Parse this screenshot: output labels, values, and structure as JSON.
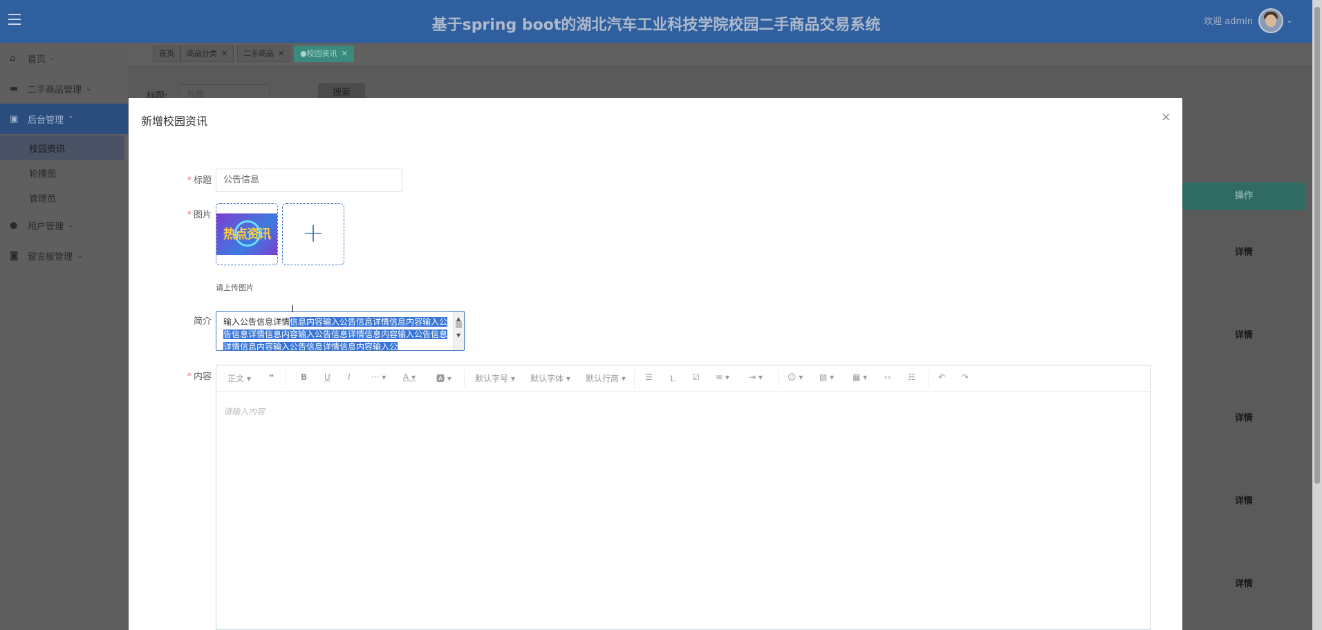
{
  "header": {
    "title": "基于spring boot的湖北汽车工业科技学院校园二手商品交易系统",
    "welcome": "欢迎 admin"
  },
  "sidebar": {
    "items": [
      {
        "label": "首页"
      },
      {
        "label": "二手商品管理"
      },
      {
        "label": "后台管理"
      },
      {
        "label": "用户管理"
      },
      {
        "label": "留言板管理"
      }
    ],
    "subitems": [
      {
        "label": "校园资讯"
      },
      {
        "label": "轮播图"
      },
      {
        "label": "管理员"
      }
    ]
  },
  "tabs": [
    {
      "label": "首页"
    },
    {
      "label": "商品分类"
    },
    {
      "label": "二手商品"
    },
    {
      "label": "●校园资讯"
    }
  ],
  "background": {
    "search_label": "标题:",
    "search_placeholder": "标题",
    "search_button": "搜索",
    "column_action": "操作",
    "row_action": "详情"
  },
  "dialog": {
    "title": "新增校园资讯",
    "fields": {
      "title_label": "标题",
      "title_value": "公告信息",
      "image_label": "图片",
      "image_thumb_text": "热点资讯",
      "image_tip": "请上传图片",
      "intro_label": "简介",
      "intro_plain": "输入公告信息详情",
      "intro_selected": "信息内容输入公告信息详情信息内容输入公告信息详情信息内容输入公告信息详情信息内容输入公告信息详情信息内容输入公告信息详情信息内容输入公",
      "content_label": "内容",
      "content_placeholder": "请输入内容"
    },
    "toolbar": {
      "paragraph": "正文",
      "font_size": "默认字号",
      "font_family": "默认字体",
      "line_height": "默认行高"
    }
  },
  "colors": {
    "header_bg": "#2f5f9e",
    "active_tab": "#3b8a7e",
    "accent_blue": "#3f76c4"
  }
}
